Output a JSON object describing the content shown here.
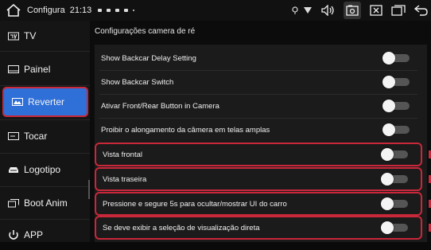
{
  "statusbar": {
    "app_title": "Configura",
    "time": "21:13",
    "icons": [
      "home-icon",
      "location-icon",
      "wifi-icon",
      "volume-icon",
      "screenshot-icon",
      "close-box-icon",
      "recent-apps-icon",
      "back-icon"
    ]
  },
  "sidebar": {
    "items": [
      {
        "label": "TV",
        "icon": "tv-icon"
      },
      {
        "label": "Painel",
        "icon": "panel-icon"
      },
      {
        "label": "Reverter",
        "icon": "reverse-camera-icon",
        "selected": true
      },
      {
        "label": "Tocar",
        "icon": "touch-icon"
      },
      {
        "label": "Logotipo",
        "icon": "car-logo-icon"
      },
      {
        "label": "Boot Anim",
        "icon": "boot-anim-icon"
      },
      {
        "label": "APP",
        "icon": "app-icon"
      }
    ]
  },
  "main": {
    "section_title": "Configurações camera de ré",
    "settings": [
      {
        "label": "Show Backcar Delay Setting",
        "on": false
      },
      {
        "label": "Show Backcar Switch",
        "on": false
      },
      {
        "label": "Ativar Front/Rear Button in Camera",
        "on": false
      },
      {
        "label": "Proibir o alongamento da câmera em telas amplas",
        "on": false
      },
      {
        "label": "Vista frontal",
        "on": false
      },
      {
        "label": "Vista traseira",
        "on": false
      },
      {
        "label": "Pressione e segure 5s para ocultar/mostrar UI do carro",
        "on": false
      },
      {
        "label": "Se deve exibir a seleção de visualização direta",
        "on": false
      }
    ]
  },
  "colors": {
    "selected_bg": "#2f6fd8",
    "highlight_border": "#c8283a"
  }
}
